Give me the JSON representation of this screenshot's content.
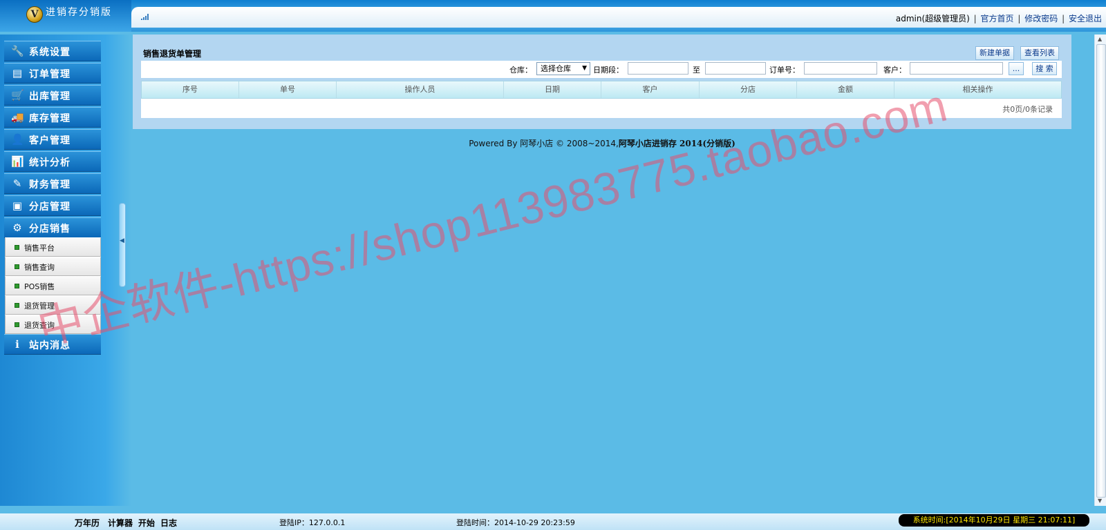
{
  "header": {
    "logo_badge": "V",
    "app_title": "进销存分销版",
    "user": "admin(超级管理员)",
    "links": [
      "官方首页",
      "修改密码",
      "安全退出"
    ],
    "signal_icon": "signal-icon"
  },
  "sidebar": {
    "menu": [
      {
        "label": "系统设置",
        "icon": "wrench-icon"
      },
      {
        "label": "订单管理",
        "icon": "order-icon"
      },
      {
        "label": "出库管理",
        "icon": "cart-icon"
      },
      {
        "label": "库存管理",
        "icon": "truck-icon"
      },
      {
        "label": "客户管理",
        "icon": "customer-icon"
      },
      {
        "label": "统计分析",
        "icon": "bar-chart-icon"
      },
      {
        "label": "财务管理",
        "icon": "finance-icon"
      },
      {
        "label": "分店管理",
        "icon": "branch-icon"
      },
      {
        "label": "分店销售",
        "icon": "gear-icon"
      }
    ],
    "submenu": [
      "销售平台",
      "销售查询",
      "POS销售",
      "退货管理",
      "退货查询"
    ],
    "bottom_menu": {
      "label": "站内消息",
      "icon": "info-icon"
    }
  },
  "main": {
    "title": "销售退货单管理",
    "buttons": {
      "new_doc": "新建单据",
      "view_list": "查看列表"
    },
    "filters": {
      "warehouse_label": "仓库：",
      "warehouse_value": "选择仓库",
      "date_label": "日期段：",
      "date_to": "至",
      "order_label": "订单号：",
      "customer_label": "客户：",
      "picker_btn": "...",
      "search_btn": "搜 索"
    },
    "columns": [
      "序号",
      "单号",
      "操作人员",
      "日期",
      "客户",
      "分店",
      "金额",
      "相关操作"
    ],
    "page_info": "共0页/0条记录"
  },
  "footer": {
    "powered": "Powered By 阿琴小店 © 2008~2014,",
    "product": "阿琴小店进销存 2014(分销版)"
  },
  "statusbar": {
    "links": [
      "万年历",
      "计算器",
      "开始",
      "日志"
    ],
    "login_ip": "登陆IP：127.0.0.1",
    "login_time": "登陆时间：2014-10-29 20:23:59",
    "system_time": "系统时间:[2014年10月29日 星期三 21:07:11]"
  },
  "watermark": "中企软件-https://shop113983775.taobao.com"
}
